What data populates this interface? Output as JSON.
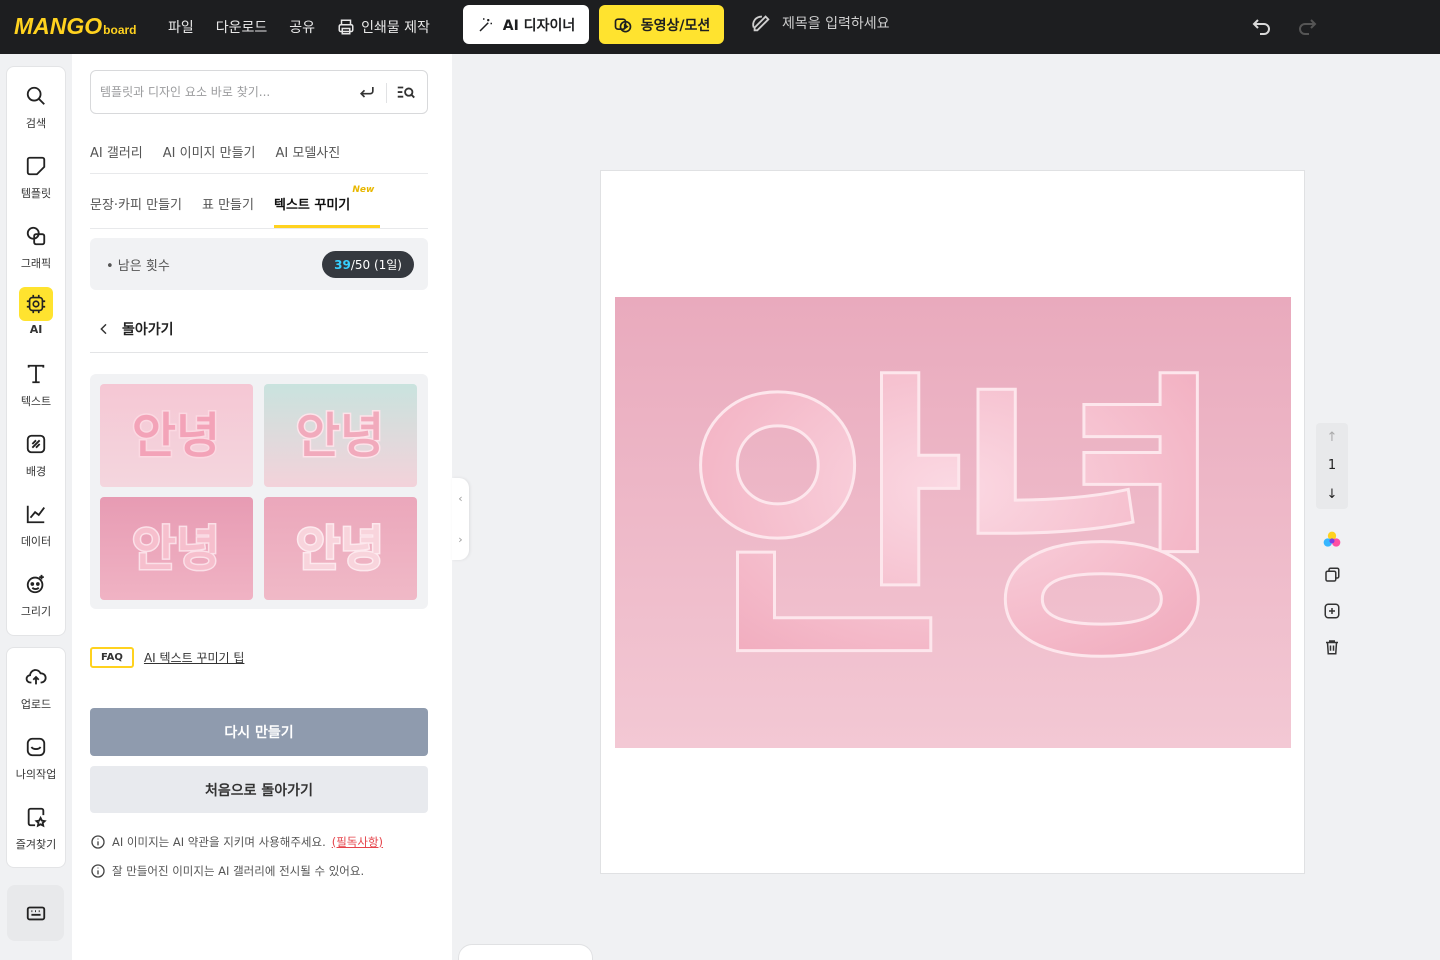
{
  "app": {
    "logo": "MANGO",
    "logo_sub": "board"
  },
  "topbar": {
    "menu": [
      "파일",
      "다운로드",
      "공유",
      "인쇄물 제작"
    ],
    "ai_designer_label": "AI 디자이너",
    "video_motion_label": "동영상/모션",
    "title_placeholder": "제목을 입력하세요"
  },
  "rail": {
    "items": [
      {
        "label": "검색",
        "icon": "search-icon"
      },
      {
        "label": "템플릿",
        "icon": "template-icon"
      },
      {
        "label": "그래픽",
        "icon": "graphic-icon"
      },
      {
        "label": "AI",
        "icon": "ai-chip-icon",
        "active": true
      },
      {
        "label": "텍스트",
        "icon": "text-icon"
      },
      {
        "label": "배경",
        "icon": "background-icon"
      },
      {
        "label": "데이터",
        "icon": "chart-icon"
      },
      {
        "label": "그리기",
        "icon": "draw-icon"
      }
    ],
    "items2": [
      {
        "label": "업로드",
        "icon": "upload-icon"
      },
      {
        "label": "나의작업",
        "icon": "my-work-icon"
      },
      {
        "label": "즐겨찾기",
        "icon": "favorites-icon"
      }
    ]
  },
  "panel": {
    "search_placeholder": "템플릿과 디자인 요소 바로 찾기...",
    "tabs_row1": [
      "AI 갤러리",
      "AI 이미지 만들기",
      "AI 모델사진"
    ],
    "tabs_row2": [
      "문장·카피 만들기",
      "표 만들기",
      "텍스트 꾸미기"
    ],
    "new_badge": "New",
    "remaining_label": "• 남은 횟수",
    "remaining_used": "39",
    "remaining_total": "/50 (1일)",
    "back_label": "돌아가기",
    "faq_badge": "FAQ",
    "faq_link": "AI 텍스트 꾸미기 팁",
    "remake_button": "다시 만들기",
    "restart_button": "처음으로 돌아가기",
    "notice1": "AI 이미지는 AI 약관을 지키며 사용해주세요.",
    "notice1_link": "(필독사항)",
    "notice2": "잘 만들어진 이미지는 AI 갤러리에 전시될 수 있어요."
  },
  "results": {
    "image_text": "안녕",
    "count": 4
  },
  "canvas": {
    "art_text": "안녕",
    "page_number": "1"
  },
  "colors": {
    "accent": "#ffe32f",
    "topbar": "#1d1e20",
    "pink": "#f3b6c8"
  }
}
